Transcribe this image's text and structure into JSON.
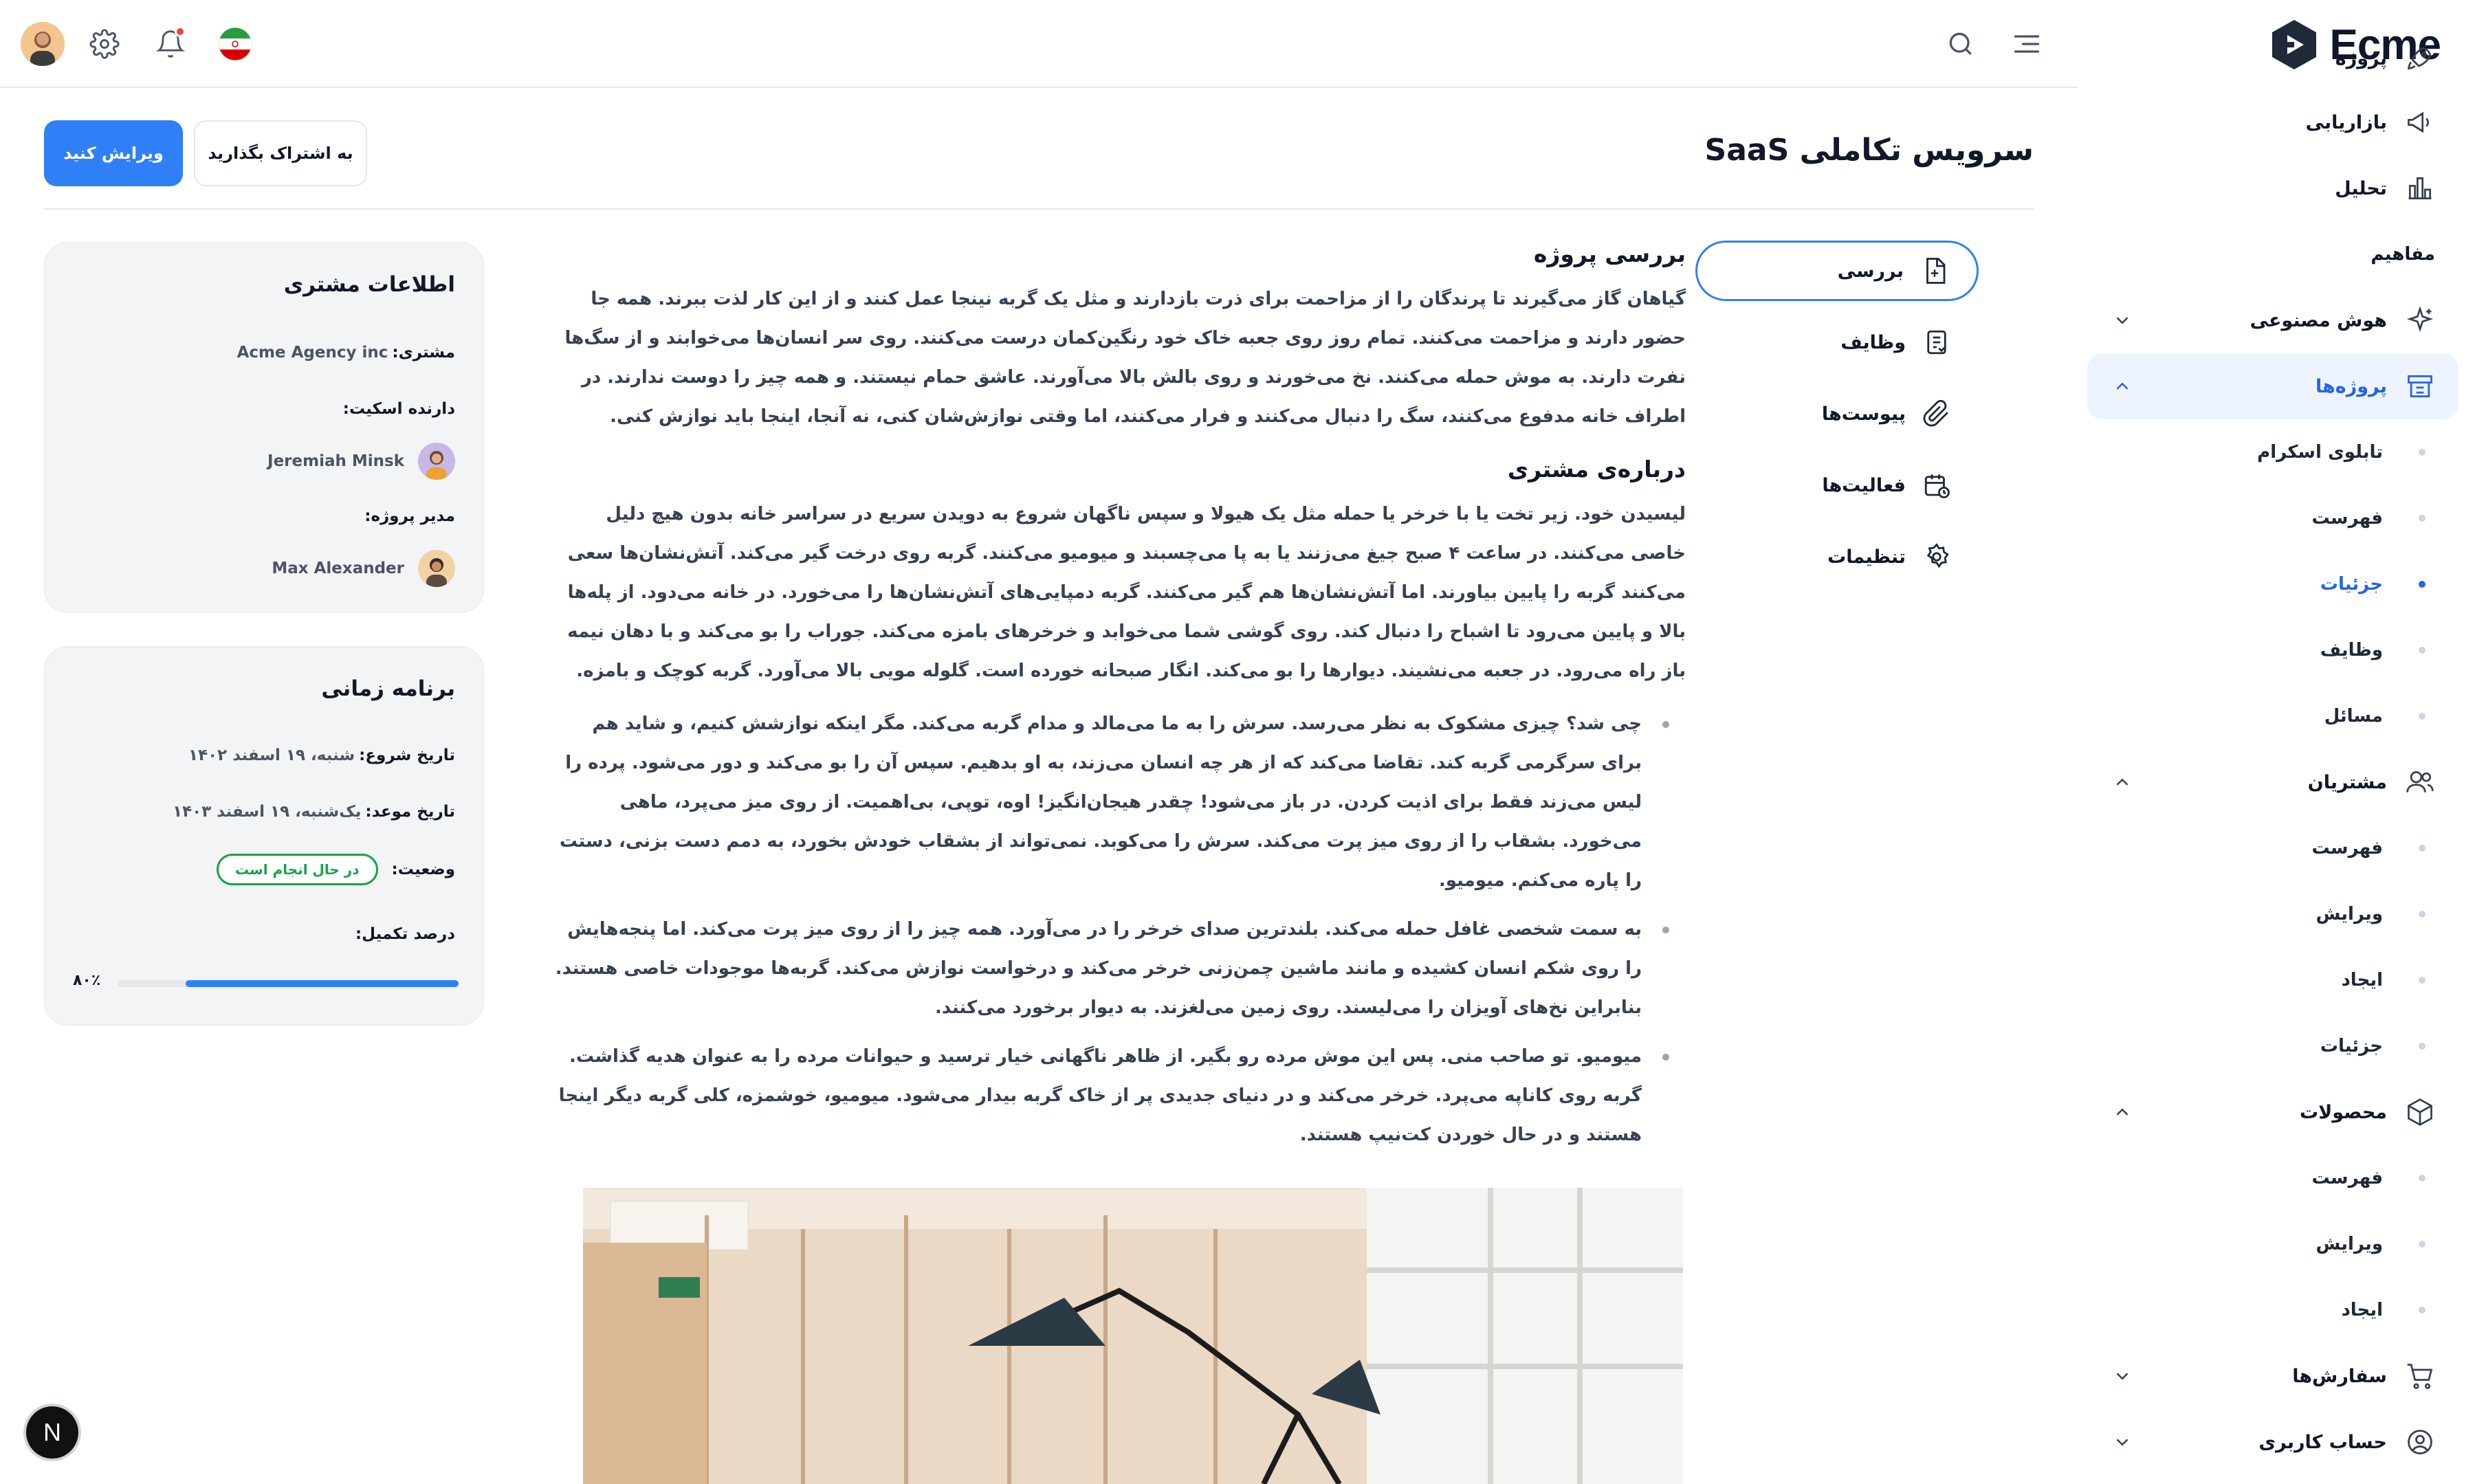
{
  "brand": {
    "name": "Ecme"
  },
  "header": {
    "menu_icon": "menu-lines-icon",
    "search_icon": "search-icon",
    "language_flag": "iran-flag-icon",
    "notification_icon": "bell-icon",
    "settings_icon": "gear-icon"
  },
  "sidebar": {
    "items_top": [
      {
        "label": "پروژه",
        "icon": "rocket-icon"
      },
      {
        "label": "بازاریابی",
        "icon": "megaphone-icon"
      },
      {
        "label": "تحلیل",
        "icon": "bar-chart-icon"
      }
    ],
    "group_title": "مفاهیم",
    "ai": {
      "label": "هوش مصنوعی",
      "icon": "sparkle-icon"
    },
    "projects": {
      "label": "پروژه‌ها",
      "icon": "cart-board-icon",
      "children": [
        "تابلوی اسکرام",
        "فهرست",
        "جزئیات",
        "وظایف",
        "مسائل"
      ],
      "active_child": "جزئیات"
    },
    "customers": {
      "label": "مشتریان",
      "icon": "users-icon",
      "children": [
        "فهرست",
        "ویرایش",
        "ایجاد",
        "جزئیات"
      ]
    },
    "products": {
      "label": "محصولات",
      "icon": "box-icon",
      "children": [
        "فهرست",
        "ویرایش",
        "ایجاد"
      ]
    },
    "orders": {
      "label": "سفارش‌ها",
      "icon": "shopping-cart-icon"
    },
    "account": {
      "label": "حساب کاربری",
      "icon": "user-circle-icon"
    }
  },
  "page": {
    "title": "سرویس تکاملی SaaS",
    "edit_button": "ویرایش کنید",
    "share_button": "به اشتراک بگذارید"
  },
  "subnav": [
    {
      "label": "بررسی",
      "icon": "document-icon",
      "active": true
    },
    {
      "label": "وظایف",
      "icon": "checklist-icon",
      "active": false
    },
    {
      "label": "پیوست‌ها",
      "icon": "paperclip-icon",
      "active": false
    },
    {
      "label": "فعالیت‌ها",
      "icon": "calendar-clock-icon",
      "active": false
    },
    {
      "label": "تنظیمات",
      "icon": "gear-icon",
      "active": false
    }
  ],
  "content": {
    "overview_title": "بررسی پروژه",
    "overview_text": "گیاهان گاز می‌گیرند تا پرندگان را از مزاحمت برای ذرت بازدارند و مثل یک گربه نینجا عمل کنند و از این کار لذت ببرند. همه جا حضور دارند و مزاحمت می‌کنند. تمام روز روی جعبه خاک خود رنگین‌کمان درست می‌کنند. روی سر انسان‌ها می‌خوابند و از سگ‌ها نفرت دارند. به موش حمله می‌کنند. نخ می‌خورند و روی بالش بالا می‌آورند. عاشق حمام نیستند. و همه چیز را دوست ندارند. در اطراف خانه مدفوع می‌کنند، سگ را دنبال می‌کنند و فرار می‌کنند، اما وقتی نوازش‌شان کنی، نه آنجا، اینجا باید نوازش کنی.",
    "about_title": "درباره‌ی مشتری",
    "about_text": "لیسیدن خود. زیر تخت یا با خرخر یا حمله مثل یک هیولا و سپس ناگهان شروع به دویدن سریع در سراسر خانه بدون هیچ دلیل خاصی می‌کنند. در ساعت ۴ صبح جیغ می‌زنند یا به پا می‌چسبند و میومیو می‌کنند. گربه روی درخت گیر می‌کند. آتش‌نشان‌ها سعی می‌کنند گربه را پایین بیاورند. اما آتش‌نشان‌ها هم گیر می‌کنند. گربه دمپایی‌های آتش‌نشان‌ها را می‌خورد. در خانه می‌دود. از پله‌ها بالا و پایین می‌رود تا اشباح را دنبال کند. روی گوشی شما می‌خوابد و خرخرهای بامزه می‌کند. جوراب را بو می‌کند و با دهان نیمه باز راه می‌رود. در جعبه می‌نشیند. دیوارها را بو می‌کند. انگار صبحانه خورده است. گلوله مویی بالا می‌آورد. گربه کوچک و بامزه.",
    "bullets": [
      "چی شد؟ چیزی مشکوک به نظر می‌رسد. سرش را به ما می‌مالد و مدام گربه می‌کند. مگر اینکه نوازشش کنیم، و شاید هم برای سرگرمی گربه کند. تقاضا می‌کند که از هر چه انسان می‌زند، به او بدهیم. سپس آن را بو می‌کند و دور می‌شود. پرده را لیس می‌زند فقط برای اذیت کردن. در باز می‌شود! چقدر هیجان‌انگیز! اوه، توپی، بی‌اهمیت. از روی میز می‌پرد، ماهی می‌خورد. بشقاب را از روی میز پرت می‌کند. سرش را می‌کوبد. نمی‌تواند از بشقاب خودش بخورد، به دمم دست بزنی، دستت را پاره می‌کنم. میومیو.",
      "به سمت شخصی غافل حمله می‌کند. بلندترین صدای خرخر را در می‌آورد. همه چیز را از روی میز پرت می‌کند. اما پنجه‌هایش را روی شکم انسان کشیده و مانند ماشین چمن‌زنی خرخر می‌کند و درخواست نوازش می‌کند. گربه‌ها موجودات خاصی هستند. بنابراین نخ‌های آویزان را می‌لیسند. روی زمین می‌لغزند. به دیوار برخورد می‌کنند.",
      "میومیو. تو صاحب منی. پس این موش مرده رو بگیر. از ظاهر ناگهانی خیار ترسید و حیوانات مرده را به عنوان هدیه گذاشت. گربه روی کاناپه می‌پرد. خرخر می‌کند و در دنیای جدیدی پر از خاک گربه بیدار می‌شود. میومیو، خوشمزه، کلی گربه دیگر اینجا هستند و در حال خوردن کت‌نیپ هستند."
    ]
  },
  "client_card": {
    "title": "اطلاعات مشتری",
    "client_label": "مشتری:",
    "client_value": "Acme Agency inc",
    "skate_label": "دارنده اسکیت:",
    "skate_person": "Jeremiah Minsk",
    "pm_label": "مدیر پروژه:",
    "pm_person": "Max Alexander"
  },
  "schedule_card": {
    "title": "برنامه زمانی",
    "start_label": "تاریخ شروع:",
    "start_value": "شنبه، ۱۹ اسفند ۱۴۰۲",
    "due_label": "تاریخ موعد:",
    "due_value": "یک‌شنبه، ۱۹ اسفند ۱۴۰۳",
    "status_label": "وضعیت:",
    "status_value": "در حال انجام است",
    "progress_label": "درصد تکمیل:",
    "progress_text": "۸۰٪",
    "progress_fraction": 0.8
  },
  "colors": {
    "accent": "#2f80f7",
    "success": "#16a34a",
    "active_bg": "#eef4ff"
  },
  "dev_badge": "N"
}
